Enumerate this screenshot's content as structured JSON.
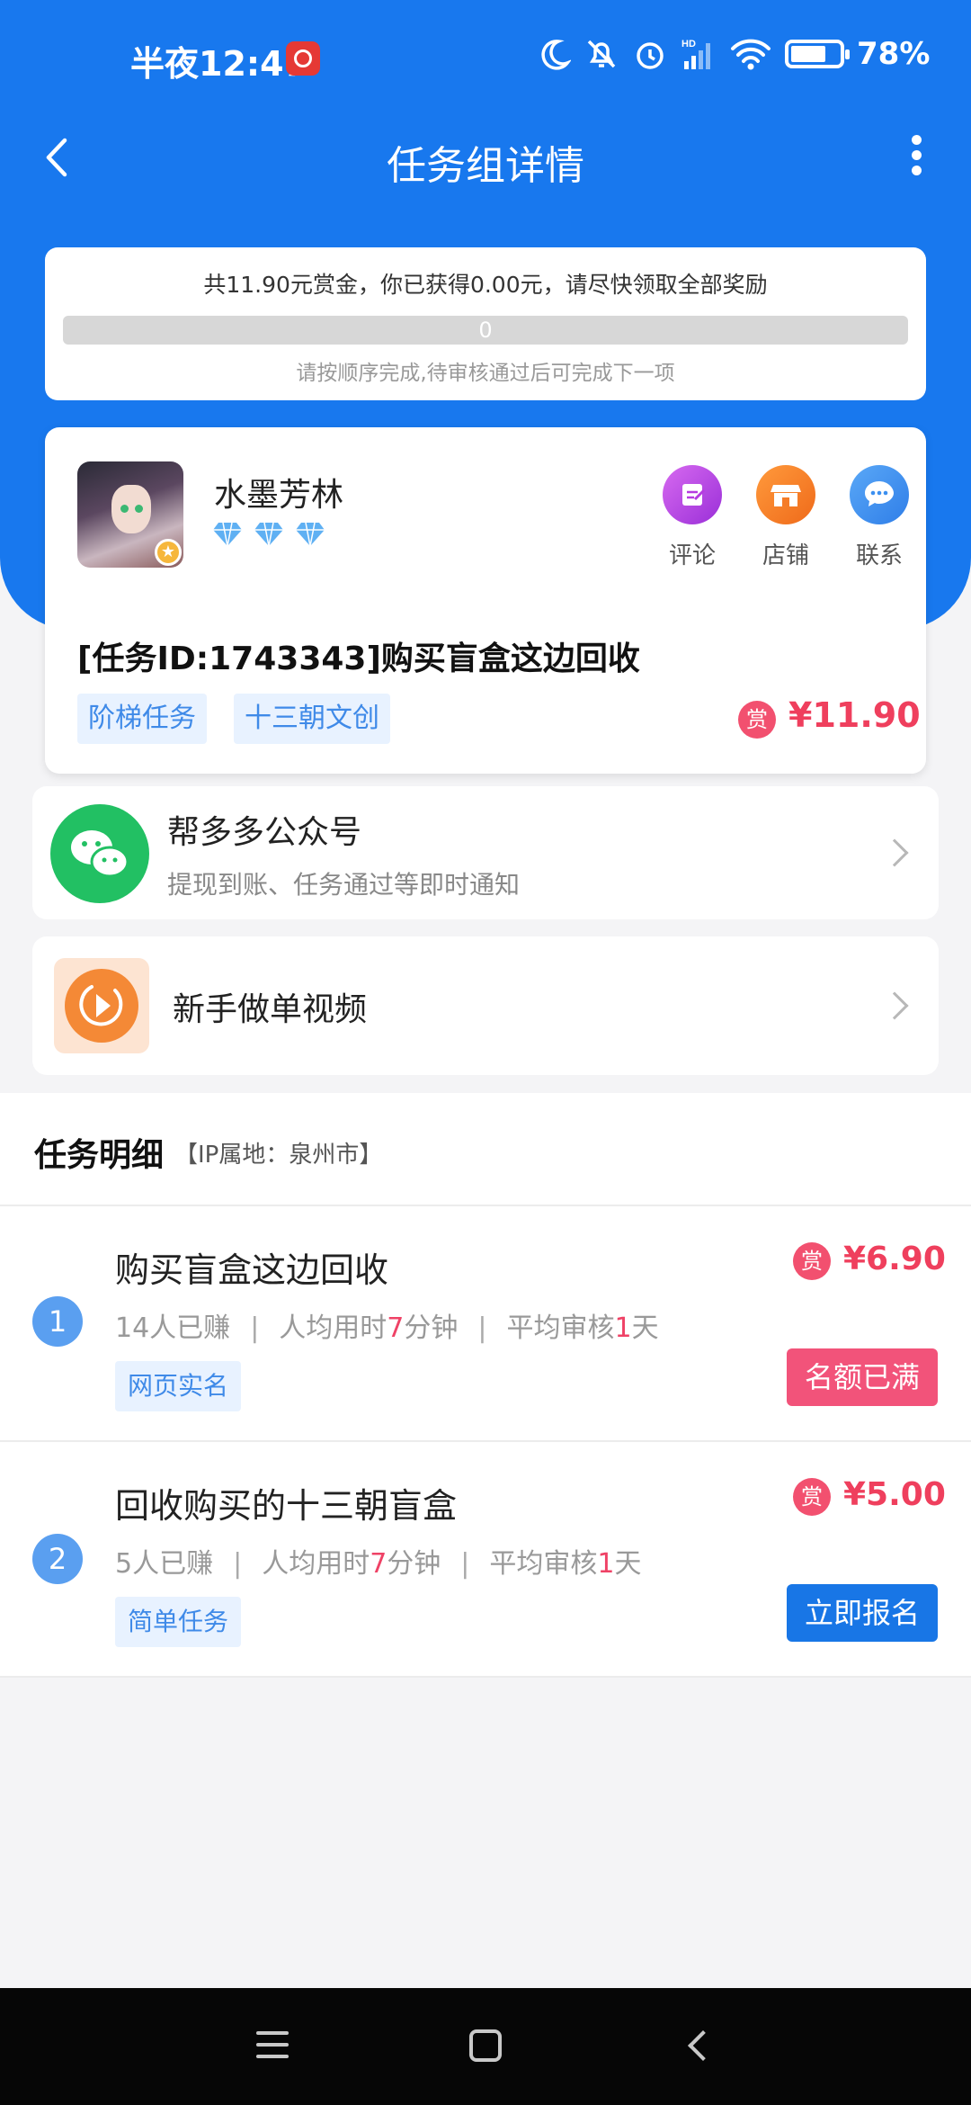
{
  "status_bar": {
    "time": "半夜12:47",
    "battery_pct": "78%",
    "battery_level": 0.78,
    "network": "HD"
  },
  "nav": {
    "title": "任务组详情"
  },
  "reward": {
    "summary": "共11.90元赏金，你已获得0.00元，请尽快领取全部奖励",
    "progress_label": "0",
    "progress_value": 0,
    "hint": "请按顺序完成,待审核通过后可完成下一项"
  },
  "task": {
    "shop_name": "水墨芳林",
    "diamond_count": 3,
    "actions": [
      {
        "label": "评论",
        "icon": "comment-edit-icon",
        "color": "#b53be0"
      },
      {
        "label": "店铺",
        "icon": "store-icon",
        "color": "#f57c28"
      },
      {
        "label": "联系",
        "icon": "chat-icon",
        "color": "#3b8ff0"
      }
    ],
    "title": "[任务ID:1743343]购买盲盒这边回收",
    "tags": [
      "阶梯任务",
      "十三朝文创"
    ],
    "reward_badge": "赏",
    "price": "¥11.90"
  },
  "wechat": {
    "title": "帮多多公众号",
    "subtitle": "提现到账、任务通过等即时通知"
  },
  "video": {
    "title": "新手做单视频"
  },
  "detail": {
    "title": "任务明细",
    "ip": "【IP属地：泉州市】",
    "rows": [
      {
        "num": "1",
        "title": "购买盲盒这边回收",
        "earned": "14人已赚",
        "time_prefix": "人均用时",
        "time_value": "7",
        "time_suffix": "分钟",
        "review_prefix": "平均审核",
        "review_value": "1",
        "review_suffix": "天",
        "tag": "网页实名",
        "badge": "赏",
        "price": "¥6.90",
        "button": "名额已满"
      },
      {
        "num": "2",
        "title": "回收购买的十三朝盲盒",
        "earned": "5人已赚",
        "time_prefix": "人均用时",
        "time_value": "7",
        "time_suffix": "分钟",
        "review_prefix": "平均审核",
        "review_value": "1",
        "review_suffix": "天",
        "tag": "简单任务",
        "badge": "赏",
        "price": "¥5.00",
        "button": "立即报名"
      }
    ]
  },
  "colors": {
    "brand_blue": "#1878ee",
    "price_red": "#ef3f5d",
    "wechat_green": "#22c063"
  }
}
